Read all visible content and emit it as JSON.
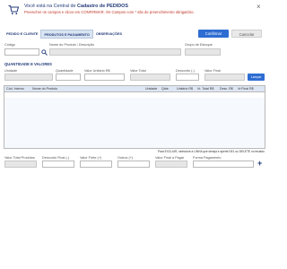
{
  "header": {
    "title_prefix": "Você está na Central de ",
    "title_bold": "Cadastro de PEDIDOS",
    "subtitle": "Preencher os campos e clicar em CONFIRMAR. Os Campos com * são de preenchimento obrigatório.",
    "close_label": "×"
  },
  "tabs": [
    {
      "label": "PEDIDO E CLIENTE"
    },
    {
      "label": "PRODUTOS E PAGAMENTO"
    },
    {
      "label": "OBSERVAÇÕES"
    }
  ],
  "actions": {
    "confirm_label": "Confirmar",
    "cancel_label": "Cancelar"
  },
  "product_search": {
    "codigo_label": "Código",
    "nome_label": "Nome do Produto / Descrição",
    "grupo_label": "Grupo de Estoque"
  },
  "qty_section": {
    "title": "QUANTIDADE E VALORES",
    "unidade_label": "Unidade",
    "quantidade_label": "Quantidade",
    "valor_unitario_label": "Valor Unitário R$",
    "valor_total_label": "Valor Total",
    "desconto_label": "Desconto (-)",
    "valor_final_label": "Valor Final",
    "lancar_label": "Lançar"
  },
  "items_table": {
    "columns": [
      "Cód. Interno",
      "Nome do Produto",
      "Unidade",
      "Qtde.",
      "Unitário R$",
      "Vr. Total R$",
      "Desc. R$",
      "Vr.Final R$"
    ],
    "rows": []
  },
  "note": "Para EXCLUIR, selecione a LINHA que deseja e aperte DEL ou DELETE no teclado",
  "totals": {
    "valor_total_produtos_label": "Valor Total Produtos",
    "desconto_final_label": "Desconto Final (-)",
    "valor frete_label": "Valor Frete (+)",
    "outros_label": "Outros (+)",
    "valor_final_pagar_label": "Valor Final a Pagar",
    "forma_pagamento_label": "Forma Pagamento"
  },
  "colors": {
    "accent": "#2e6dd2",
    "title": "#243b7a",
    "warning": "#c0392b",
    "tab_active": "#d9e4f2"
  }
}
